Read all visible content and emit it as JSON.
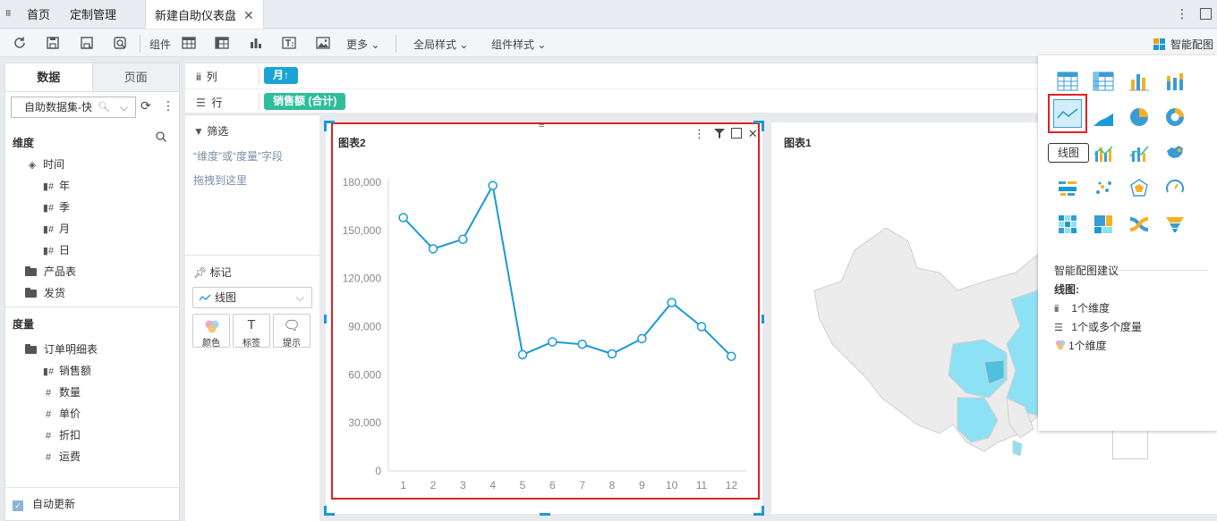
{
  "tabs": [
    {
      "label": "首页"
    },
    {
      "label": "定制管理"
    },
    {
      "label": "新建自助仪表盘",
      "active": true
    }
  ],
  "toolbar": {
    "component_label": "组件",
    "more_label": "更多",
    "global_style_label": "全局样式",
    "component_style_label": "组件样式",
    "smart_chart_label": "智能配图"
  },
  "left": {
    "tab_data": "数据",
    "tab_page": "页面",
    "dataset": "自助数据集-快",
    "dimension_header": "维度",
    "time_label": "时间",
    "time_fields": [
      "年",
      "季",
      "月",
      "日"
    ],
    "product_table": "产品表",
    "shipping": "发货",
    "measure_header": "度量",
    "order_table": "订单明细表",
    "measures": [
      "销售额",
      "数量",
      "单价",
      "折扣",
      "运费"
    ],
    "auto_update": "自动更新"
  },
  "shelves": {
    "col_label": "列",
    "col_pill": "月↑",
    "row_label": "行",
    "row_pill": "销售额 (合计)",
    "col_pill_color": "#1aa3d4",
    "row_pill_color": "#2fbd9a"
  },
  "filter": {
    "title": "筛选",
    "hint1": "“维度”或“度量”字段",
    "hint2": "拖拽到这里"
  },
  "mark": {
    "title": "标记",
    "type": "线图",
    "btn_color": "颜色",
    "btn_label": "标签",
    "btn_tooltip": "提示"
  },
  "cards": {
    "chart2_title": "图表2",
    "chart1_title": "图表1"
  },
  "chart_data": {
    "type": "line",
    "categories": [
      "1",
      "2",
      "3",
      "4",
      "5",
      "6",
      "7",
      "8",
      "9",
      "10",
      "11",
      "12"
    ],
    "values": [
      158000,
      138500,
      144500,
      178000,
      72500,
      80500,
      79000,
      73000,
      82500,
      105000,
      90000,
      71500
    ],
    "ylim": [
      0,
      180000
    ],
    "yticks": [
      0,
      30000,
      60000,
      90000,
      120000,
      150000,
      180000
    ],
    "ytick_labels": [
      "0",
      "30,000",
      "60,000",
      "90,000",
      "120,000",
      "150,000",
      "180,000"
    ],
    "color": "#1a9ad6",
    "title": "图表2"
  },
  "popup": {
    "tooltip": "线图",
    "suggest_title": "智能配图建议",
    "suggest_head": "线图:",
    "suggest_items": [
      "1个维度",
      "1个或多个度量",
      "1个维度"
    ]
  }
}
